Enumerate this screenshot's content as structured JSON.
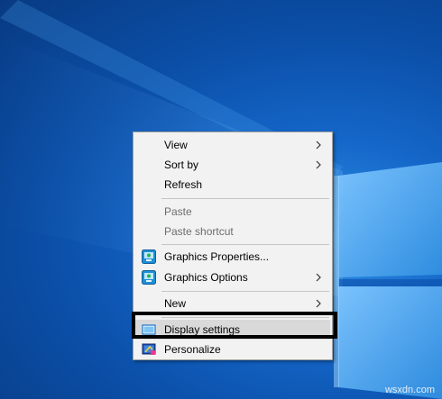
{
  "desktop": {
    "background_color": "#0b4fa8",
    "watermark": "wsxdn.com"
  },
  "context_menu": {
    "items": [
      {
        "label": "View",
        "submenu": true,
        "disabled": false,
        "icon": null
      },
      {
        "label": "Sort by",
        "submenu": true,
        "disabled": false,
        "icon": null
      },
      {
        "label": "Refresh",
        "submenu": false,
        "disabled": false,
        "icon": null
      },
      {
        "label": "Paste",
        "submenu": false,
        "disabled": true,
        "icon": null
      },
      {
        "label": "Paste shortcut",
        "submenu": false,
        "disabled": true,
        "icon": null
      },
      {
        "label": "Graphics Properties...",
        "submenu": false,
        "disabled": false,
        "icon": "intel-graphics-icon"
      },
      {
        "label": "Graphics Options",
        "submenu": true,
        "disabled": false,
        "icon": "intel-graphics-icon"
      },
      {
        "label": "New",
        "submenu": true,
        "disabled": false,
        "icon": null
      },
      {
        "label": "Display settings",
        "submenu": false,
        "disabled": false,
        "icon": "display-icon",
        "highlighted": true
      },
      {
        "label": "Personalize",
        "submenu": false,
        "disabled": false,
        "icon": "personalize-icon"
      }
    ]
  }
}
